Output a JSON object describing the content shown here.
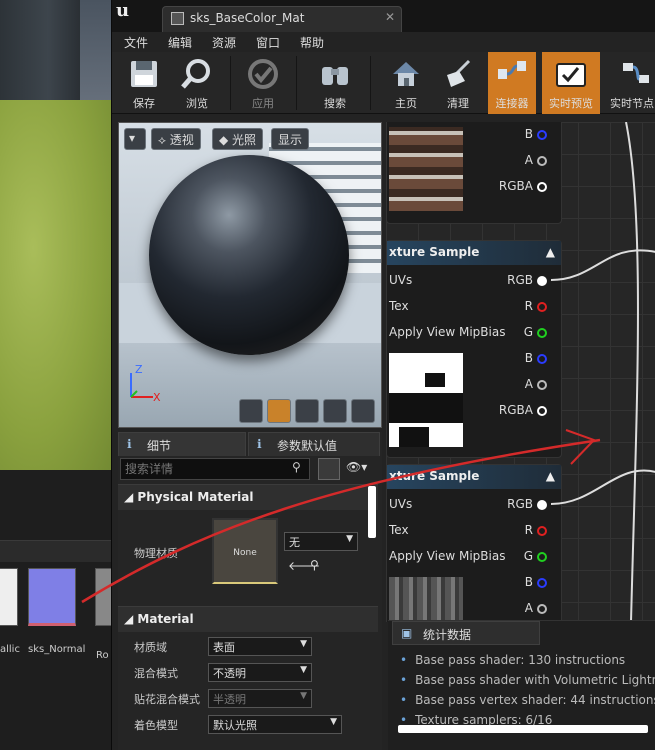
{
  "colors": {
    "accent": "#d07a22",
    "node_header": "#27455f",
    "arrow": "#d42a2a"
  },
  "content_browser": {
    "labels": [
      "allic",
      "sks_Normal",
      "Ro"
    ]
  },
  "window": {
    "tab_title": "sks_BaseColor_Mat",
    "menu": [
      "文件",
      "编辑",
      "资源",
      "窗口",
      "帮助"
    ],
    "toolbar": [
      {
        "label": "保存",
        "icon": "save-icon"
      },
      {
        "label": "浏览",
        "icon": "browse-icon"
      },
      {
        "label": "应用",
        "icon": "apply-icon"
      },
      {
        "label": "搜索",
        "icon": "search-icon"
      },
      {
        "label": "主页",
        "icon": "home-icon"
      },
      {
        "label": "清理",
        "icon": "clean-icon"
      },
      {
        "label": "连接器",
        "icon": "connector-icon"
      },
      {
        "label": "实时预览",
        "icon": "live-preview-icon"
      },
      {
        "label": "实时节点",
        "icon": "live-nodes-icon"
      }
    ]
  },
  "viewport": {
    "perspective": "透视",
    "lit": "光照",
    "show": "显示",
    "axis": {
      "x": "X",
      "z": "Z"
    }
  },
  "details": {
    "tab_details": "细节",
    "tab_params": "参数默认值",
    "search_placeholder": "搜索详情",
    "physical_section": "Physical Material",
    "phys_label": "物理材质",
    "phys_thumb": "None",
    "phys_value": "无",
    "material_section": "Material",
    "rows": [
      {
        "label": "材质域",
        "value": "表面"
      },
      {
        "label": "混合模式",
        "value": "不透明"
      },
      {
        "label": "贴花混合模式",
        "value": "半透明"
      },
      {
        "label": "着色模型",
        "value": "默认光照"
      }
    ]
  },
  "graph": {
    "node0": {
      "pins": [
        "B",
        "A",
        "RGBA"
      ]
    },
    "node1": {
      "title": "xture Sample",
      "inputs": [
        "UVs",
        "Tex",
        "Apply View MipBias"
      ],
      "outputs": [
        "RGB",
        "R",
        "G",
        "B",
        "A",
        "RGBA"
      ]
    },
    "node2": {
      "title": "xture Sample",
      "inputs": [
        "UVs",
        "Tex",
        "Apply View MipBias"
      ],
      "outputs": [
        "RGB",
        "R",
        "G",
        "B",
        "A"
      ]
    }
  },
  "stats": {
    "tab": "统计数据",
    "lines": [
      "Base pass shader: 130 instructions",
      "Base pass shader with Volumetric Lightmap",
      "Base pass vertex shader: 44 instructions",
      "Texture samplers: 6/16"
    ]
  }
}
